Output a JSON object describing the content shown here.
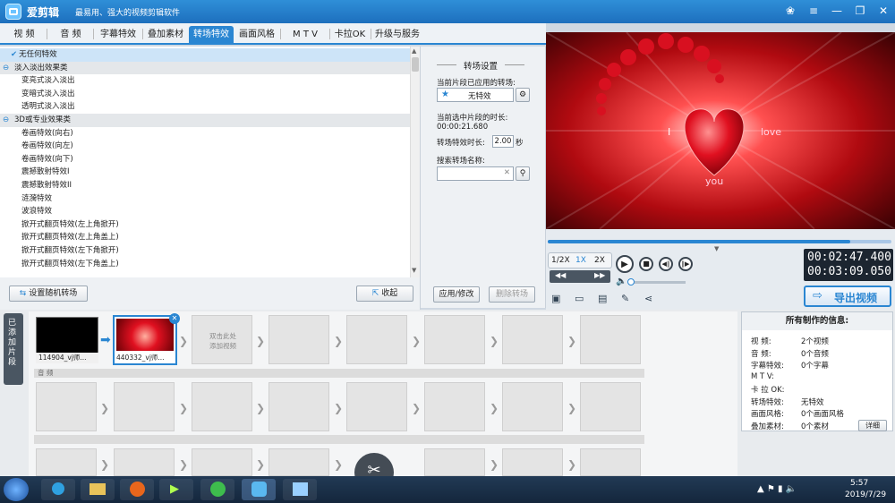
{
  "app": {
    "name": "爱剪辑",
    "slogan": "最易用、强大的视频剪辑软件"
  },
  "window_controls": [
    "skin",
    "menu",
    "minimize",
    "restore",
    "close"
  ],
  "tabs": [
    "视 频",
    "音 频",
    "字幕特效",
    "叠加素材",
    "转场特效",
    "画面风格",
    "M T V",
    "卡拉OK",
    "升级与服务"
  ],
  "active_tab": "转场特效",
  "effects": [
    {
      "label": "无任何特效",
      "type": "selected"
    },
    {
      "label": "淡入淡出效果类",
      "type": "group"
    },
    {
      "label": "变亮式淡入淡出",
      "type": "item"
    },
    {
      "label": "变暗式淡入淡出",
      "type": "item"
    },
    {
      "label": "透明式淡入淡出",
      "type": "item"
    },
    {
      "label": "3D或专业效果类",
      "type": "group"
    },
    {
      "label": "卷画特效(向右)",
      "type": "item"
    },
    {
      "label": "卷画特效(向左)",
      "type": "item"
    },
    {
      "label": "卷画特效(向下)",
      "type": "item"
    },
    {
      "label": "震撼散射特效I",
      "type": "item"
    },
    {
      "label": "震撼散射特效II",
      "type": "item"
    },
    {
      "label": "涟漪特效",
      "type": "item"
    },
    {
      "label": "波浪特效",
      "type": "item"
    },
    {
      "label": "掀开式翻页特效(左上角掀开)",
      "type": "item"
    },
    {
      "label": "掀开式翻页特效(左上角盖上)",
      "type": "item"
    },
    {
      "label": "掀开式翻页特效(左下角掀开)",
      "type": "item"
    },
    {
      "label": "掀开式翻页特效(左下角盖上)",
      "type": "item"
    }
  ],
  "list_footer": {
    "random_label": "设置随机转场",
    "collapse_label": "收起"
  },
  "settings": {
    "title": "转场设置",
    "applied_label": "当前片段已应用的转场:",
    "applied_value": "无特效",
    "clip_duration_label": "当前选中片段的时长:",
    "clip_duration_value": "00:00:21.680",
    "duration_label": "转场特效时长:",
    "duration_value": "2.00",
    "duration_unit": "秒",
    "search_label": "搜索转场名称:",
    "search_value": "",
    "apply_label": "应用/修改",
    "delete_label": "删除转场"
  },
  "preview": {
    "word_left": "I",
    "word_right": "love",
    "word_bottom": "you",
    "progress": 0.88
  },
  "player": {
    "speeds": [
      "1/2X",
      "1X",
      "2X"
    ],
    "active_speed": "1X",
    "time_current": "00:02:47.400",
    "time_total": "00:03:09.050",
    "volume": 0.0,
    "export_label": "导出视频"
  },
  "timeline": {
    "side_label": "已添加片段",
    "clips": [
      {
        "name": "114904_vj师..."
      },
      {
        "name": "440332_vj师..."
      }
    ],
    "placeholder": "双击此处\n添加视频",
    "audio_label": "音 频"
  },
  "info": {
    "title": "所有制作的信息:",
    "rows": [
      {
        "k": "视    频:",
        "v": "2个视频"
      },
      {
        "k": "音    频:",
        "v": "0个音频"
      },
      {
        "k": "字幕特效:",
        "v": "0个字幕"
      },
      {
        "k": "M  T  V:",
        "v": ""
      },
      {
        "k": "卡 拉 OK:",
        "v": ""
      },
      {
        "k": "转场特效:",
        "v": "无特效"
      },
      {
        "k": "画面风格:",
        "v": "0个画面风格"
      },
      {
        "k": "叠加素材:",
        "v": "0个素材"
      }
    ],
    "detail_label": "详细"
  },
  "taskbar": {
    "time": "5:57",
    "date": "2019/7/29"
  },
  "colors": {
    "accent": "#2a86d2",
    "heart": "#e01020"
  }
}
